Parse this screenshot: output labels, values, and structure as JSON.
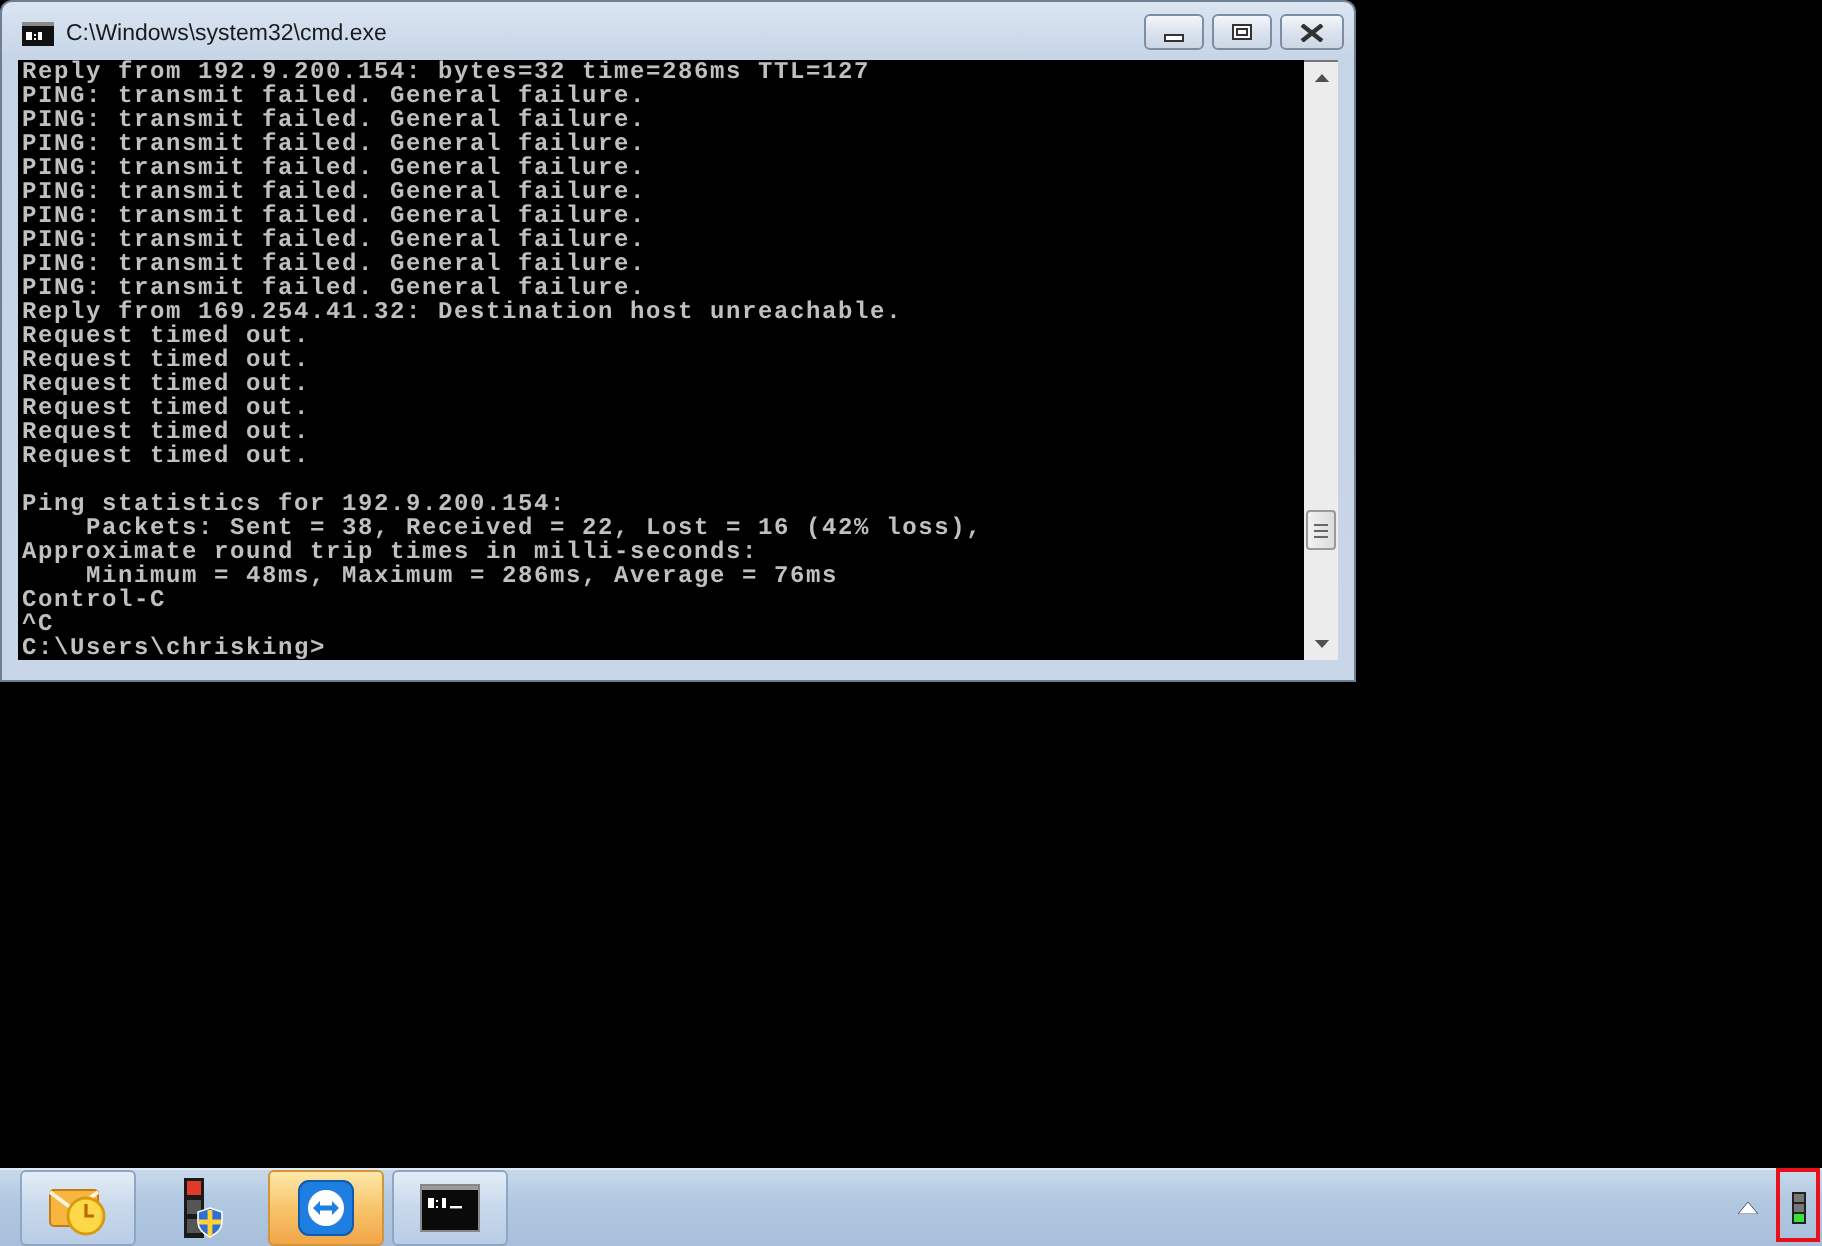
{
  "window": {
    "title": "C:\\Windows\\system32\\cmd.exe"
  },
  "console": {
    "blocks": [
      {
        "lines": [
          "Reply from 192.9.200.154: bytes=32 time=286ms TTL=127",
          "PING: transmit failed. General failure.",
          "PING: transmit failed. General failure.",
          "PING: transmit failed. General failure.",
          "PING: transmit failed. General failure.",
          "PING: transmit failed. General failure.",
          "PING: transmit failed. General failure.",
          "PING: transmit failed. General failure.",
          "PING: transmit failed. General failure.",
          "PING: transmit failed. General failure.",
          "Reply from 169.254.41.32: Destination host unreachable.",
          "Request timed out.",
          "Request timed out.",
          "Request timed out.",
          "Request timed out.",
          "Request timed out.",
          "Request timed out."
        ]
      },
      {
        "lines": [
          "Ping statistics for 192.9.200.154:",
          "    Packets: Sent = 38, Received = 22, Lost = 16 (42% loss),",
          "Approximate round trip times in milli-seconds:",
          "    Minimum = 48ms, Maximum = 286ms, Average = 76ms",
          "Control-C",
          "^C",
          "C:\\Users\\chrisking>"
        ]
      }
    ]
  },
  "taskbar": {
    "buttons": [
      {
        "kind": "mail",
        "running": true,
        "flashing": false
      },
      {
        "kind": "status",
        "running": false,
        "flashing": false
      },
      {
        "kind": "remote",
        "running": true,
        "flashing": true
      },
      {
        "kind": "console",
        "running": true,
        "flashing": false
      }
    ]
  },
  "tray": {
    "highlighted": true
  }
}
